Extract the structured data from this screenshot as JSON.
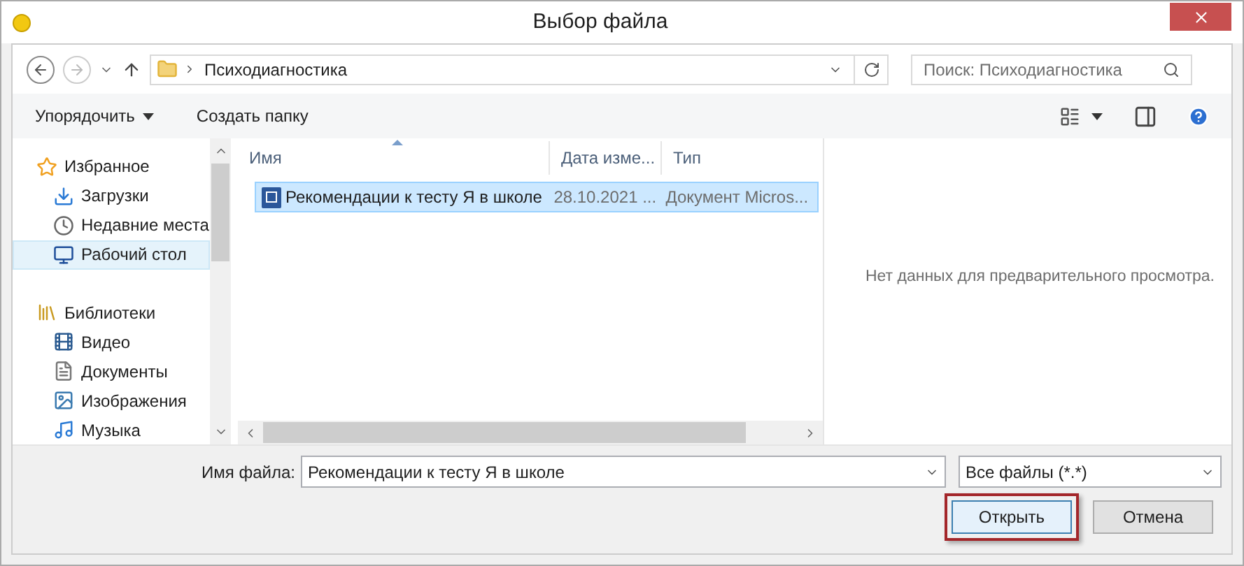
{
  "window": {
    "title": "Выбор файла"
  },
  "address": {
    "path": "Психодиагностика"
  },
  "search": {
    "placeholder": "Поиск: Психодиагностика"
  },
  "toolbar": {
    "organize": "Упорядочить",
    "new_folder": "Создать папку"
  },
  "sidebar": {
    "items": [
      {
        "kind": "group",
        "label": "Избранное",
        "selected": false
      },
      {
        "kind": "item",
        "label": "Загрузки",
        "selected": false
      },
      {
        "kind": "item",
        "label": "Недавние места",
        "selected": false
      },
      {
        "kind": "item",
        "label": "Рабочий стол",
        "selected": true
      },
      {
        "kind": "spacer"
      },
      {
        "kind": "group",
        "label": "Библиотеки",
        "selected": false
      },
      {
        "kind": "item",
        "label": "Видео",
        "selected": false
      },
      {
        "kind": "item",
        "label": "Документы",
        "selected": false
      },
      {
        "kind": "item",
        "label": "Изображения",
        "selected": false
      },
      {
        "kind": "item",
        "label": "Музыка",
        "selected": false
      }
    ]
  },
  "table": {
    "columns": [
      "Имя",
      "Дата изме...",
      "Тип"
    ],
    "rows": [
      {
        "cells": [
          "Рекомендации к тесту Я в школе",
          "28.10.2021 ...",
          "Документ Micros..."
        ],
        "selected": true
      }
    ]
  },
  "preview": {
    "message": "Нет данных для предварительного просмотра."
  },
  "footer": {
    "filename_label": "Имя файла:",
    "filename": "Рекомендации к тесту Я в школе",
    "filter": "Все файлы (*.*)",
    "buttons": [
      {
        "label": "Открыть",
        "kind": "primary",
        "highlighted": true
      },
      {
        "label": "Отмена",
        "kind": "secondary",
        "highlighted": false
      }
    ]
  }
}
